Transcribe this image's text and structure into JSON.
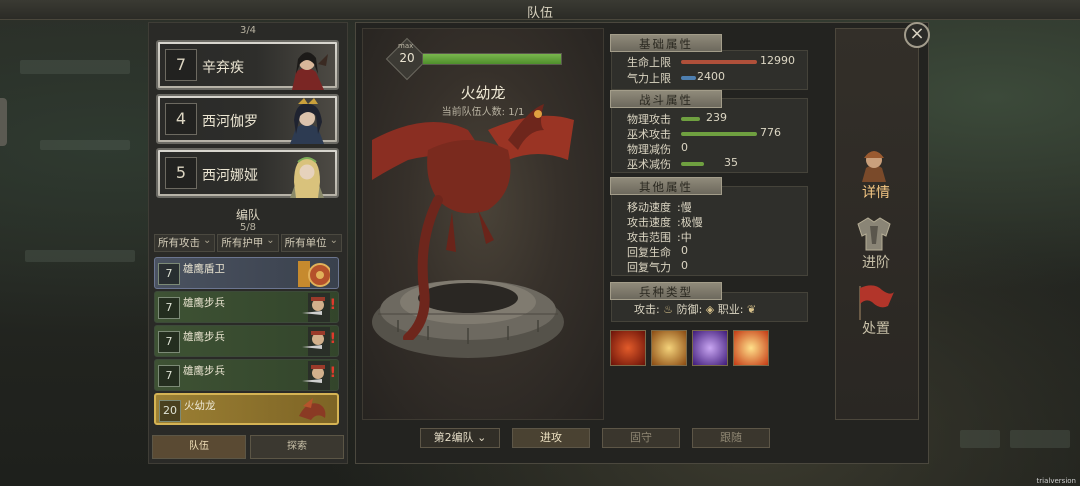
{
  "window": {
    "title": "队伍"
  },
  "heroes": {
    "count": "3/4",
    "list": [
      {
        "level": "7",
        "name": "辛弃疾"
      },
      {
        "level": "4",
        "name": "西河伽罗"
      },
      {
        "level": "5",
        "name": "西河娜娅"
      }
    ]
  },
  "squad": {
    "label": "编队",
    "count": "5/8",
    "filters": [
      "所有攻击",
      "所有护甲",
      "所有单位"
    ],
    "units": [
      {
        "level": "7",
        "name": "雄鹰盾卫",
        "style": "shield"
      },
      {
        "level": "7",
        "name": "雄鹰步兵",
        "style": "green",
        "alert": "!"
      },
      {
        "level": "7",
        "name": "雄鹰步兵",
        "style": "green",
        "alert": "!"
      },
      {
        "level": "7",
        "name": "雄鹰步兵",
        "style": "green",
        "alert": "!"
      },
      {
        "level": "20",
        "name": "火幼龙",
        "style": "gold"
      }
    ]
  },
  "left_tabs": [
    "队伍",
    "探索"
  ],
  "detail": {
    "level": "20",
    "level_max_label": "max",
    "hp_fill": 1.0,
    "unit_name": "火幼龙",
    "team_count": "当前队伍人数: 1/1"
  },
  "base_stats": {
    "header": "基础属性",
    "rows": [
      {
        "label": "生命上限",
        "value": "12990",
        "bar_fraction": 1.0,
        "bar_color": "#b0503a"
      },
      {
        "label": "气力上限",
        "value": "2400",
        "bar_fraction": 0.2,
        "bar_color": "#4e7fb0"
      }
    ]
  },
  "combat_stats": {
    "header": "战斗属性",
    "rows": [
      {
        "label": "物理攻击",
        "value": "239",
        "bar_fraction": 0.25,
        "bar_color": "#6fa040"
      },
      {
        "label": "巫术攻击",
        "value": "776",
        "bar_fraction": 1.0,
        "bar_color": "#6fa040"
      },
      {
        "label": "物理减伤",
        "value": "0",
        "bar_fraction": 0,
        "bar_color": "#6fa040"
      },
      {
        "label": "巫术减伤",
        "value": "35",
        "bar_fraction": 0.3,
        "bar_color": "#6fa040"
      }
    ]
  },
  "other_stats": {
    "header": "其他属性",
    "rows": [
      {
        "label": "移动速度",
        "value": ":慢"
      },
      {
        "label": "攻击速度",
        "value": ":极慢"
      },
      {
        "label": "攻击范围",
        "value": ":中"
      },
      {
        "label": "回复生命",
        "value": "0"
      },
      {
        "label": "回复气力",
        "value": "0"
      }
    ]
  },
  "unit_type": {
    "header": "兵种类型",
    "attack_label": "攻击:",
    "defense_label": "防御:",
    "class_label": "职业:"
  },
  "skills": [
    {
      "icon": "fire-dragon-skill-icon",
      "color": "#c2331f"
    },
    {
      "icon": "burst-strike-skill-icon",
      "color": "#d8a032"
    },
    {
      "icon": "twin-spirit-skill-icon",
      "color": "#7a4cc4"
    },
    {
      "icon": "radiant-burst-skill-icon",
      "color": "#e0602a"
    }
  ],
  "bottom_buttons": {
    "squad_select": "第2编队",
    "attack": "进攻",
    "hold": "固守",
    "follow": "跟随"
  },
  "right_tabs": [
    {
      "label": "详情",
      "active": true
    },
    {
      "label": "进阶",
      "active": false
    },
    {
      "label": "处置",
      "active": false
    }
  ],
  "watermark": "trialversion"
}
